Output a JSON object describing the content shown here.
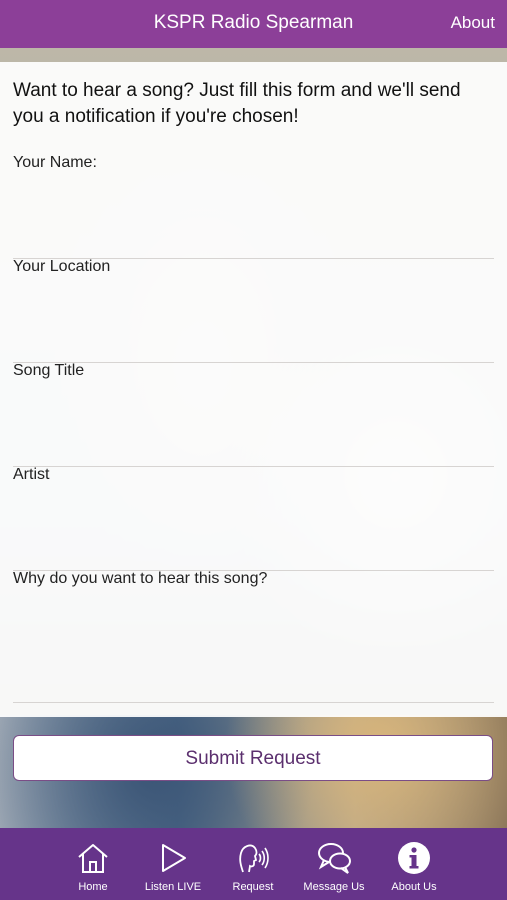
{
  "app": {
    "title": "KSPR Radio Spearman",
    "about_label": "About"
  },
  "form": {
    "intro": "Want to hear a song? Just fill this form and we'll send you a notification if you're chosen!",
    "fields": [
      {
        "label": "Your Name:",
        "value": ""
      },
      {
        "label": "Your Location",
        "value": ""
      },
      {
        "label": "Song Title",
        "value": ""
      },
      {
        "label": "Artist",
        "value": ""
      },
      {
        "label": "Why do you want to hear this song?",
        "value": ""
      }
    ],
    "submit_label": "Submit Request"
  },
  "nav": {
    "items": [
      {
        "label": "Home",
        "icon": "home-icon"
      },
      {
        "label": "Listen LIVE",
        "icon": "play-icon"
      },
      {
        "label": "Request",
        "icon": "person-speaking-icon"
      },
      {
        "label": "Message Us",
        "icon": "chat-bubbles-icon"
      },
      {
        "label": "About Us",
        "icon": "info-icon"
      }
    ]
  },
  "colors": {
    "header": "#8c3f98",
    "nav": "#66348a",
    "button_text": "#5b2f6e"
  }
}
